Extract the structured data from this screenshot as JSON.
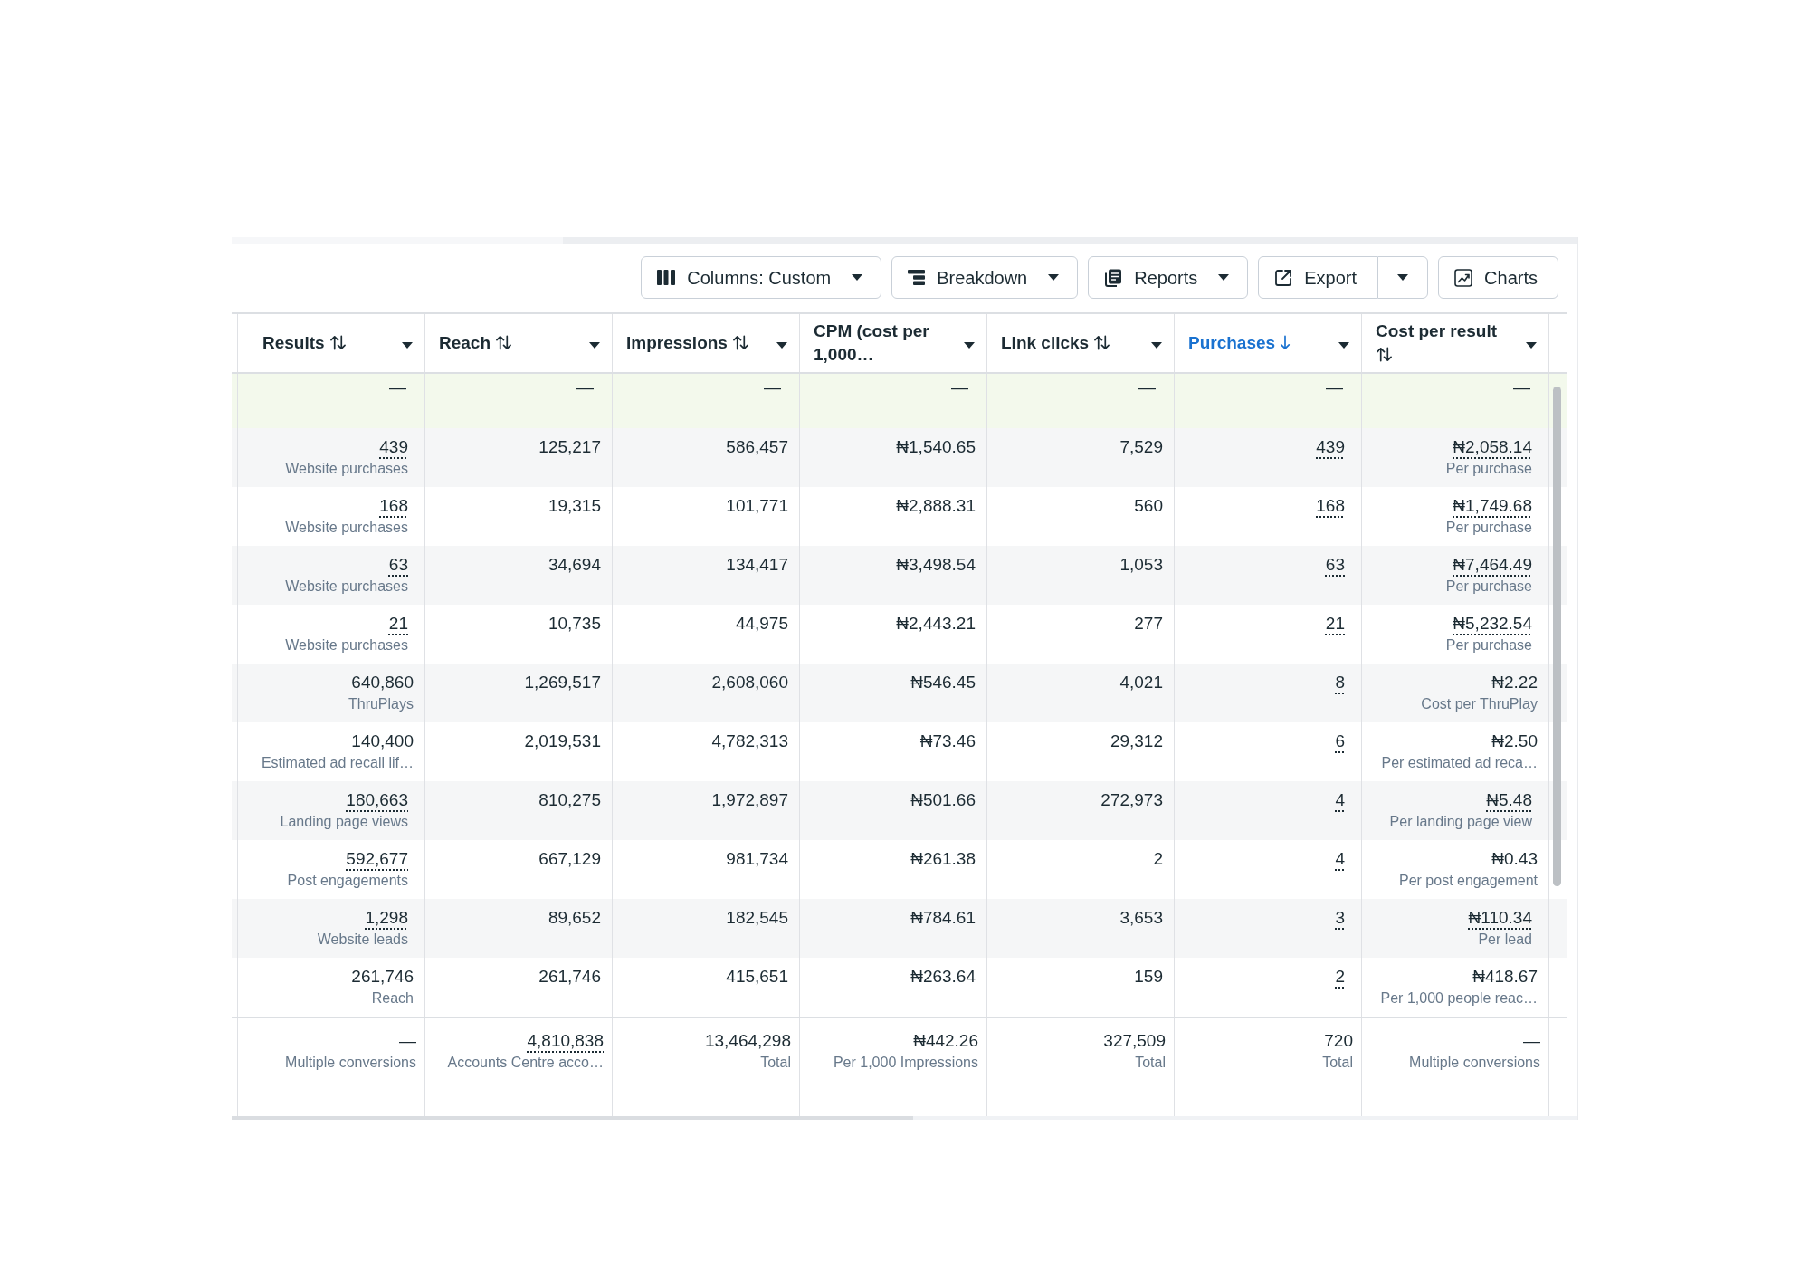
{
  "toolbar": {
    "buttons": [
      {
        "label": "Columns: Custom",
        "kind": "dropdown"
      },
      {
        "label": "Breakdown",
        "kind": "dropdown"
      },
      {
        "label": "Reports",
        "kind": "dropdown"
      },
      {
        "label": "Export",
        "kind": "split"
      },
      {
        "label": "Charts",
        "kind": "plain"
      }
    ]
  },
  "table": {
    "columns": [
      {
        "label": "Results",
        "sorted": false
      },
      {
        "label": "Reach",
        "sorted": false
      },
      {
        "label": "Impressions",
        "sorted": false
      },
      {
        "label": "CPM (cost per 1,000…"
      },
      {
        "label": "Link clicks",
        "sorted": false
      },
      {
        "label": "Purchases",
        "sorted": true
      },
      {
        "label": "Cost per result",
        "sorted": false
      }
    ],
    "summary_row": [
      "—",
      "—",
      "—",
      "—",
      "—",
      "—",
      "—"
    ],
    "rows": [
      {
        "cells": [
          {
            "value": "439",
            "dotted": true,
            "note": "Website purchases"
          },
          {
            "value": "125,217",
            "dotted": false
          },
          {
            "value": "586,457",
            "dotted": false
          },
          {
            "value": "₦1,540.65",
            "dotted": false
          },
          {
            "value": "7,529",
            "dotted": false
          },
          {
            "value": "439",
            "dotted": true
          },
          {
            "value": "₦2,058.14",
            "dotted": true,
            "note": "Per purchase"
          }
        ]
      },
      {
        "cells": [
          {
            "value": "168",
            "dotted": true,
            "note": "Website purchases"
          },
          {
            "value": "19,315",
            "dotted": false
          },
          {
            "value": "101,771",
            "dotted": false
          },
          {
            "value": "₦2,888.31",
            "dotted": false
          },
          {
            "value": "560",
            "dotted": false
          },
          {
            "value": "168",
            "dotted": true
          },
          {
            "value": "₦1,749.68",
            "dotted": true,
            "note": "Per purchase"
          }
        ]
      },
      {
        "cells": [
          {
            "value": "63",
            "dotted": true,
            "note": "Website purchases"
          },
          {
            "value": "34,694",
            "dotted": false
          },
          {
            "value": "134,417",
            "dotted": false
          },
          {
            "value": "₦3,498.54",
            "dotted": false
          },
          {
            "value": "1,053",
            "dotted": false
          },
          {
            "value": "63",
            "dotted": true
          },
          {
            "value": "₦7,464.49",
            "dotted": true,
            "note": "Per purchase"
          }
        ]
      },
      {
        "cells": [
          {
            "value": "21",
            "dotted": true,
            "note": "Website purchases"
          },
          {
            "value": "10,735",
            "dotted": false
          },
          {
            "value": "44,975",
            "dotted": false
          },
          {
            "value": "₦2,443.21",
            "dotted": false
          },
          {
            "value": "277",
            "dotted": false
          },
          {
            "value": "21",
            "dotted": true
          },
          {
            "value": "₦5,232.54",
            "dotted": true,
            "note": "Per purchase"
          }
        ]
      },
      {
        "cells": [
          {
            "value": "640,860",
            "dotted": false,
            "note": "ThruPlays"
          },
          {
            "value": "1,269,517",
            "dotted": false
          },
          {
            "value": "2,608,060",
            "dotted": false
          },
          {
            "value": "₦546.45",
            "dotted": false
          },
          {
            "value": "4,021",
            "dotted": false
          },
          {
            "value": "8",
            "dotted": true
          },
          {
            "value": "₦2.22",
            "dotted": false,
            "note": "Cost per ThruPlay"
          }
        ]
      },
      {
        "cells": [
          {
            "value": "140,400",
            "dotted": false,
            "note": "Estimated ad recall lif…"
          },
          {
            "value": "2,019,531",
            "dotted": false
          },
          {
            "value": "4,782,313",
            "dotted": false
          },
          {
            "value": "₦73.46",
            "dotted": false
          },
          {
            "value": "29,312",
            "dotted": false
          },
          {
            "value": "6",
            "dotted": true
          },
          {
            "value": "₦2.50",
            "dotted": false,
            "note": "Per estimated ad reca…"
          }
        ]
      },
      {
        "cells": [
          {
            "value": "180,663",
            "dotted": true,
            "note": "Landing page views"
          },
          {
            "value": "810,275",
            "dotted": false
          },
          {
            "value": "1,972,897",
            "dotted": false
          },
          {
            "value": "₦501.66",
            "dotted": false
          },
          {
            "value": "272,973",
            "dotted": false
          },
          {
            "value": "4",
            "dotted": true
          },
          {
            "value": "₦5.48",
            "dotted": true,
            "note": "Per landing page view"
          }
        ]
      },
      {
        "cells": [
          {
            "value": "592,677",
            "dotted": true,
            "note": "Post engagements"
          },
          {
            "value": "667,129",
            "dotted": false
          },
          {
            "value": "981,734",
            "dotted": false
          },
          {
            "value": "₦261.38",
            "dotted": false
          },
          {
            "value": "2",
            "dotted": false
          },
          {
            "value": "4",
            "dotted": true
          },
          {
            "value": "₦0.43",
            "dotted": false,
            "note": "Per post engagement"
          }
        ]
      },
      {
        "cells": [
          {
            "value": "1,298",
            "dotted": true,
            "note": "Website leads"
          },
          {
            "value": "89,652",
            "dotted": false
          },
          {
            "value": "182,545",
            "dotted": false
          },
          {
            "value": "₦784.61",
            "dotted": false
          },
          {
            "value": "3,653",
            "dotted": false
          },
          {
            "value": "3",
            "dotted": true
          },
          {
            "value": "₦110.34",
            "dotted": true,
            "note": "Per lead"
          }
        ]
      },
      {
        "cells": [
          {
            "value": "261,746",
            "dotted": false,
            "note": "Reach"
          },
          {
            "value": "261,746",
            "dotted": false
          },
          {
            "value": "415,651",
            "dotted": false
          },
          {
            "value": "₦263.64",
            "dotted": false
          },
          {
            "value": "159",
            "dotted": false
          },
          {
            "value": "2",
            "dotted": true
          },
          {
            "value": "₦418.67",
            "dotted": false,
            "note": "Per 1,000 people reac…"
          }
        ]
      }
    ],
    "totals": [
      {
        "value": "—",
        "dotted": false,
        "note": "Multiple conversions"
      },
      {
        "value": "4,810,838",
        "dotted": true,
        "note": "Accounts Centre acco…"
      },
      {
        "value": "13,464,298",
        "dotted": false,
        "note": "Total"
      },
      {
        "value": "₦442.26",
        "dotted": false,
        "note": "Per 1,000 Impressions"
      },
      {
        "value": "327,509",
        "dotted": false,
        "note": "Total"
      },
      {
        "value": "720",
        "dotted": false,
        "note": "Total"
      },
      {
        "value": "—",
        "dotted": false,
        "note": "Multiple conversions"
      }
    ]
  }
}
